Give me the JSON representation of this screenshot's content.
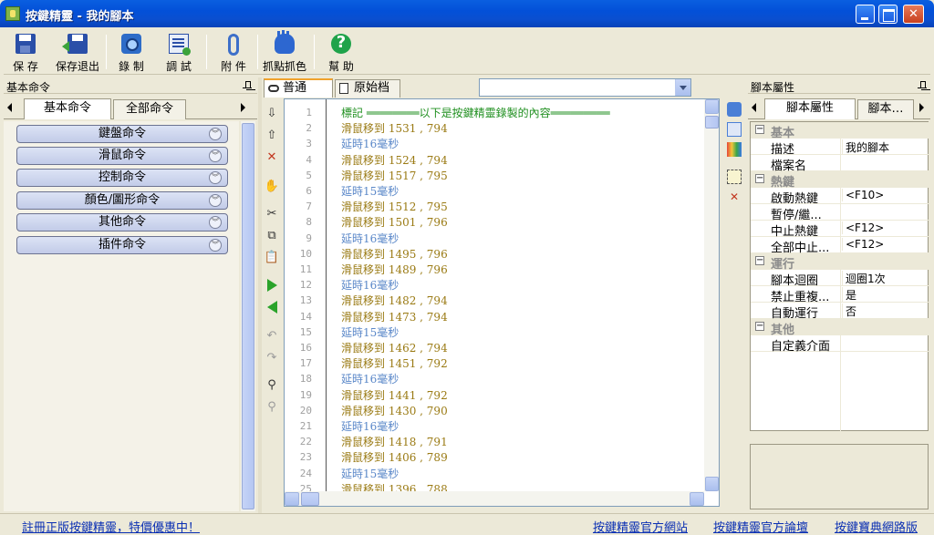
{
  "window": {
    "title": "按鍵精靈 - 我的腳本"
  },
  "toolbar": {
    "buttons": [
      {
        "label": "保 存",
        "icon": "floppy-icon"
      },
      {
        "label": "保存退出",
        "icon": "floppy-exit-icon"
      },
      {
        "label": "錄 制",
        "icon": "camera-icon"
      },
      {
        "label": "調 試",
        "icon": "debug-icon"
      },
      {
        "label": "附 件",
        "icon": "paperclip-icon"
      },
      {
        "label": "抓點抓色",
        "icon": "hand-icon"
      },
      {
        "label": "幫 助",
        "icon": "help-icon"
      }
    ]
  },
  "left_panel": {
    "title": "基本命令",
    "tabs": [
      "基本命令",
      "全部命令"
    ],
    "commands": [
      "鍵盤命令",
      "滑鼠命令",
      "控制命令",
      "顏色/圖形命令",
      "其他命令",
      "插件命令"
    ]
  },
  "editor": {
    "tabs": [
      "普通",
      "原始档"
    ],
    "combo_value": "",
    "lines": [
      {
        "n": "1",
        "text": "標記 ════════以下是按鍵精靈錄製的內容═════════",
        "kind": "label"
      },
      {
        "n": "2",
        "text": "滑鼠移到 1531 , 794",
        "kind": "move"
      },
      {
        "n": "3",
        "text": "延時16毫秒",
        "kind": "delay"
      },
      {
        "n": "4",
        "text": "滑鼠移到 1524 , 794",
        "kind": "move"
      },
      {
        "n": "5",
        "text": "滑鼠移到 1517 , 795",
        "kind": "move"
      },
      {
        "n": "6",
        "text": "延時15毫秒",
        "kind": "delay"
      },
      {
        "n": "7",
        "text": "滑鼠移到 1512 , 795",
        "kind": "move"
      },
      {
        "n": "8",
        "text": "滑鼠移到 1501 , 796",
        "kind": "move"
      },
      {
        "n": "9",
        "text": "延時16毫秒",
        "kind": "delay"
      },
      {
        "n": "10",
        "text": "滑鼠移到 1495 , 796",
        "kind": "move"
      },
      {
        "n": "11",
        "text": "滑鼠移到 1489 , 796",
        "kind": "move"
      },
      {
        "n": "12",
        "text": "延時16毫秒",
        "kind": "delay"
      },
      {
        "n": "13",
        "text": "滑鼠移到 1482 , 794",
        "kind": "move"
      },
      {
        "n": "14",
        "text": "滑鼠移到 1473 , 794",
        "kind": "move"
      },
      {
        "n": "15",
        "text": "延時15毫秒",
        "kind": "delay"
      },
      {
        "n": "16",
        "text": "滑鼠移到 1462 , 794",
        "kind": "move"
      },
      {
        "n": "17",
        "text": "滑鼠移到 1451 , 792",
        "kind": "move"
      },
      {
        "n": "18",
        "text": "延時16毫秒",
        "kind": "delay"
      },
      {
        "n": "19",
        "text": "滑鼠移到 1441 , 792",
        "kind": "move"
      },
      {
        "n": "20",
        "text": "滑鼠移到 1430 , 790",
        "kind": "move"
      },
      {
        "n": "21",
        "text": "延時16毫秒",
        "kind": "delay"
      },
      {
        "n": "22",
        "text": "滑鼠移到 1418 , 791",
        "kind": "move"
      },
      {
        "n": "23",
        "text": "滑鼠移到 1406 , 789",
        "kind": "move"
      },
      {
        "n": "24",
        "text": "延時15毫秒",
        "kind": "delay"
      },
      {
        "n": "25",
        "text": "滑鼠移到 1396 , 788",
        "kind": "move"
      }
    ]
  },
  "right_panel": {
    "title": "腳本屬性",
    "tabs": [
      "腳本屬性",
      "腳本…"
    ],
    "rows": [
      {
        "type": "cat",
        "name": "基本"
      },
      {
        "type": "prop",
        "name": "描述",
        "value": "我的腳本"
      },
      {
        "type": "prop",
        "name": "檔案名",
        "value": ""
      },
      {
        "type": "cat",
        "name": "熱鍵"
      },
      {
        "type": "prop",
        "name": "啟動熱鍵",
        "value": "<F10>"
      },
      {
        "type": "prop",
        "name": "暫停/繼...",
        "value": ""
      },
      {
        "type": "prop",
        "name": "中止熱鍵",
        "value": "<F12>"
      },
      {
        "type": "prop",
        "name": "全部中止...",
        "value": "<F12>"
      },
      {
        "type": "cat",
        "name": "運行"
      },
      {
        "type": "prop",
        "name": "腳本迴圈",
        "value": "迴圈1次"
      },
      {
        "type": "prop",
        "name": "禁止重複...",
        "value": "是"
      },
      {
        "type": "prop",
        "name": "自動運行",
        "value": "否"
      },
      {
        "type": "cat",
        "name": "其他"
      },
      {
        "type": "prop",
        "name": "自定義介面",
        "value": ""
      }
    ]
  },
  "status": {
    "register": "註冊正版按鍵精靈，特價優惠中！",
    "links": [
      "按鍵精靈官方網站",
      "按鍵精靈官方論壇",
      "按鍵寶典網路版"
    ]
  },
  "colors": {
    "label": "#1f8f1f",
    "move": "#9a7a13",
    "delay": "#5b88c9",
    "link": "#0a2fb3"
  }
}
